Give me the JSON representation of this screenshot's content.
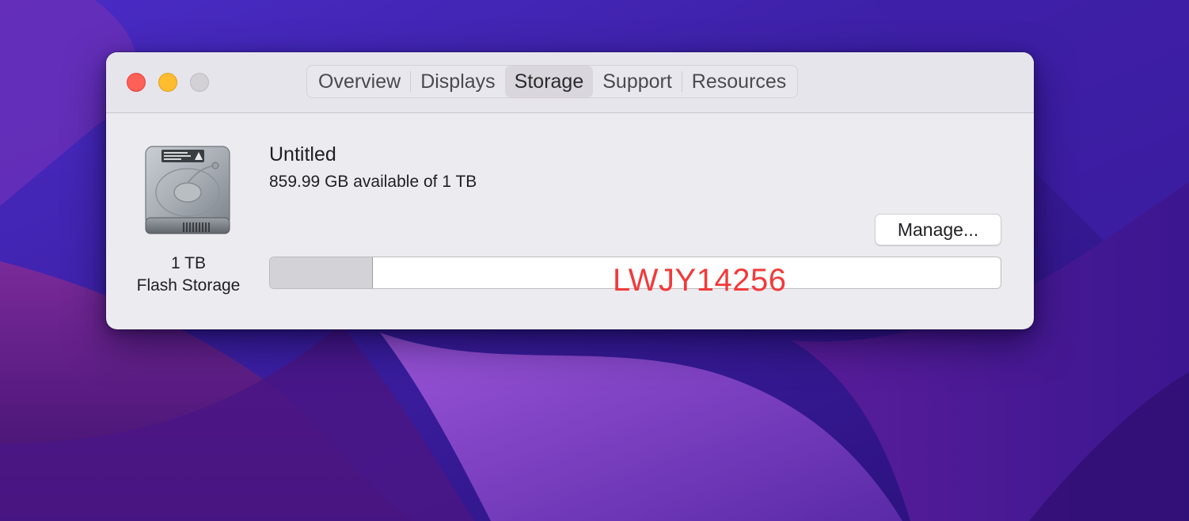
{
  "window": {
    "tabs": [
      {
        "label": "Overview",
        "active": false
      },
      {
        "label": "Displays",
        "active": false
      },
      {
        "label": "Storage",
        "active": true
      },
      {
        "label": "Support",
        "active": false
      },
      {
        "label": "Resources",
        "active": false
      }
    ]
  },
  "drive": {
    "icon": "hard-drive-icon",
    "capacity_label": "1 TB",
    "type_label": "Flash Storage"
  },
  "volume": {
    "name": "Untitled",
    "availability": "859.99 GB available of 1 TB",
    "used_fraction": 0.14,
    "manage_label": "Manage..."
  },
  "watermark": {
    "text": "LWJY14256",
    "color": "#f23a3a"
  },
  "colors": {
    "close": "#fe5f57",
    "minimize": "#febc2e",
    "zoom_inactive": "#d3d1d6"
  }
}
